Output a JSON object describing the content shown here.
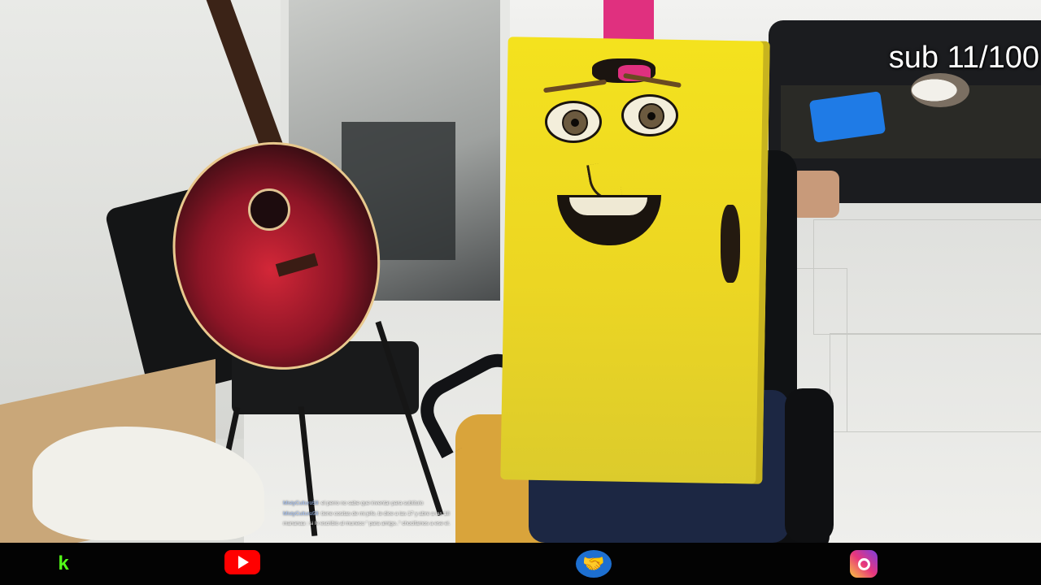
{
  "overlay": {
    "sub_counter": "sub 11/100"
  },
  "chat": {
    "lines": [
      {
        "user": "MistyCulturo59",
        "text": ": el perro no sabe que inventar para subtitulo"
      },
      {
        "user": "MistyCulturo59",
        "text": ": tiene cositas de mi jefe, te dice a las 17 y abre a las 18"
      },
      {
        "user": "",
        "text": "mananaa : si le escribio al muneco \" para amigo..\" chocifamos a ese el."
      }
    ]
  },
  "bottom_bar": {
    "icons": [
      "kick-logo-icon",
      "youtube-logo-icon",
      "handshake-icon",
      "instagram-logo-icon"
    ],
    "kick_glyph": "k",
    "handshake_glyph": "🤝",
    "colors": {
      "kick": "#53fc18",
      "youtube": "#ff0000",
      "handshake": "#1d6fd0",
      "bar": "#030303"
    }
  }
}
